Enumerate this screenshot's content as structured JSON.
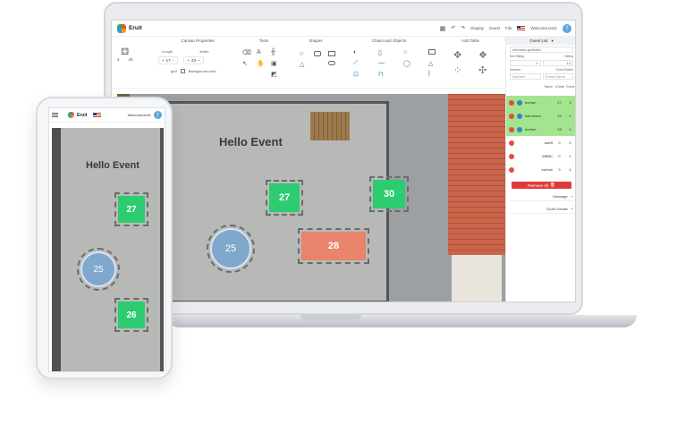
{
  "app": {
    "brand": "Eruit",
    "welcome": "Welcome,test1",
    "avatar_letter": "T",
    "menu": {
      "display": "Display",
      "guest": "Guest",
      "file": "File"
    }
  },
  "toolbar": {
    "table_counts": [
      "4",
      "40"
    ],
    "canvas_properties": {
      "title": "Canvas Properties",
      "length_label": "Length",
      "width_label": "Width",
      "length": "17",
      "width": "23",
      "grid_label": "grid",
      "background_label": "Background color"
    },
    "tools_title": "Tools",
    "shapes_title": "Shapes",
    "chairs_title": "Chairs and Objects",
    "add_table_title": "Add Table"
  },
  "canvas": {
    "title": "Hello Event",
    "tables": [
      {
        "label": "27",
        "kind": "square"
      },
      {
        "label": "30",
        "kind": "square"
      },
      {
        "label": "25",
        "kind": "round"
      },
      {
        "label": "28",
        "kind": "rect"
      }
    ]
  },
  "panel": {
    "title": "Guest List",
    "guest_list_name": "michalch-guestlist",
    "not_sitting_label": "Not Sitting",
    "sitting_label": "Sitting",
    "not_sitting": "0",
    "sitting": "14",
    "number_label": "Number",
    "guest_name_label": "Guest Name",
    "number_placeholder": "Number",
    "guest_name_placeholder": "Guest Name",
    "cols": {
      "name": "Name",
      "table": "#Table",
      "guests": "Guest"
    },
    "guests": [
      {
        "name": "burhan",
        "table": "27",
        "count": "3",
        "seated": true
      },
      {
        "name": "karhmtest",
        "table": "25",
        "count": "1",
        "seated": true
      },
      {
        "name": "burhan",
        "table": "28",
        "count": "4",
        "seated": true
      },
      {
        "name": "sweft",
        "table": "0",
        "count": "0",
        "seated": false
      },
      {
        "name": "WBBC",
        "table": "0",
        "count": "2",
        "seated": false
      },
      {
        "name": "burhan",
        "table": "0",
        "count": "4",
        "seated": false
      }
    ],
    "remove_all": "Remove All",
    "message": "Message",
    "order_details": "Order Details"
  },
  "phone": {
    "brand": "Eruit",
    "welcome": "Welcome,test1",
    "avatar_letter": "T",
    "title": "Hello Event",
    "tables": [
      {
        "label": "27",
        "kind": "square"
      },
      {
        "label": "25",
        "kind": "round"
      },
      {
        "label": "26",
        "kind": "square"
      }
    ]
  }
}
